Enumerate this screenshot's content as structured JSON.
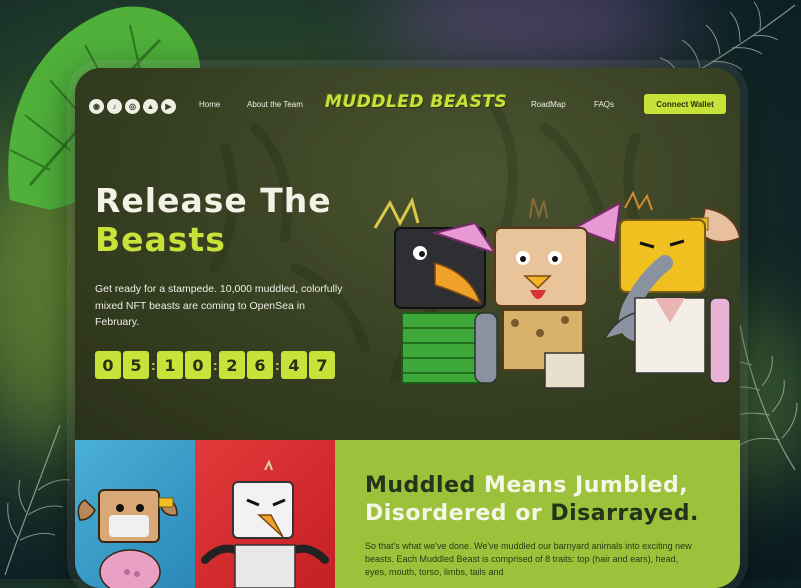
{
  "nav": {
    "socials": [
      {
        "icon": "discord-icon",
        "glyph": "◉"
      },
      {
        "icon": "twitter-icon",
        "glyph": "♪"
      },
      {
        "icon": "instagram-icon",
        "glyph": "◎"
      },
      {
        "icon": "opensea-icon",
        "glyph": "▲"
      },
      {
        "icon": "media-icon",
        "glyph": "▶"
      }
    ],
    "home": "Home",
    "team": "About the Team",
    "logo": "MUDDLED BEASTS",
    "roadmap": "RoadMap",
    "faqs": "FAQs",
    "connect_wallet": "Connect Wallet"
  },
  "hero": {
    "title_line1": "Release The",
    "title_line2": "Beasts",
    "description": "Get ready for a stampede. 10,000 muddled, colorfully mixed NFT beasts are coming to OpenSea in February.",
    "countdown": [
      "0",
      "5",
      "1",
      "0",
      "2",
      "6",
      "4",
      "7"
    ]
  },
  "section": {
    "title_w1": "Muddled",
    "title_w2": "Means Jumbled,",
    "title_w3": "Disordered or",
    "title_w4": "Disarrayed.",
    "description": "So that's what we've done. We've muddled our barnyard animals into exciting new beasts. Each Muddled Beast is comprised of 8 traits: top (hair and ears), head, eyes, mouth, torso, limbs, tails and"
  },
  "colors": {
    "accent": "#c7e33a",
    "frame_bg": "#3a4226",
    "section_green": "#9bc23a",
    "tile_blue": "#2a88b8",
    "tile_red": "#c41f25"
  }
}
